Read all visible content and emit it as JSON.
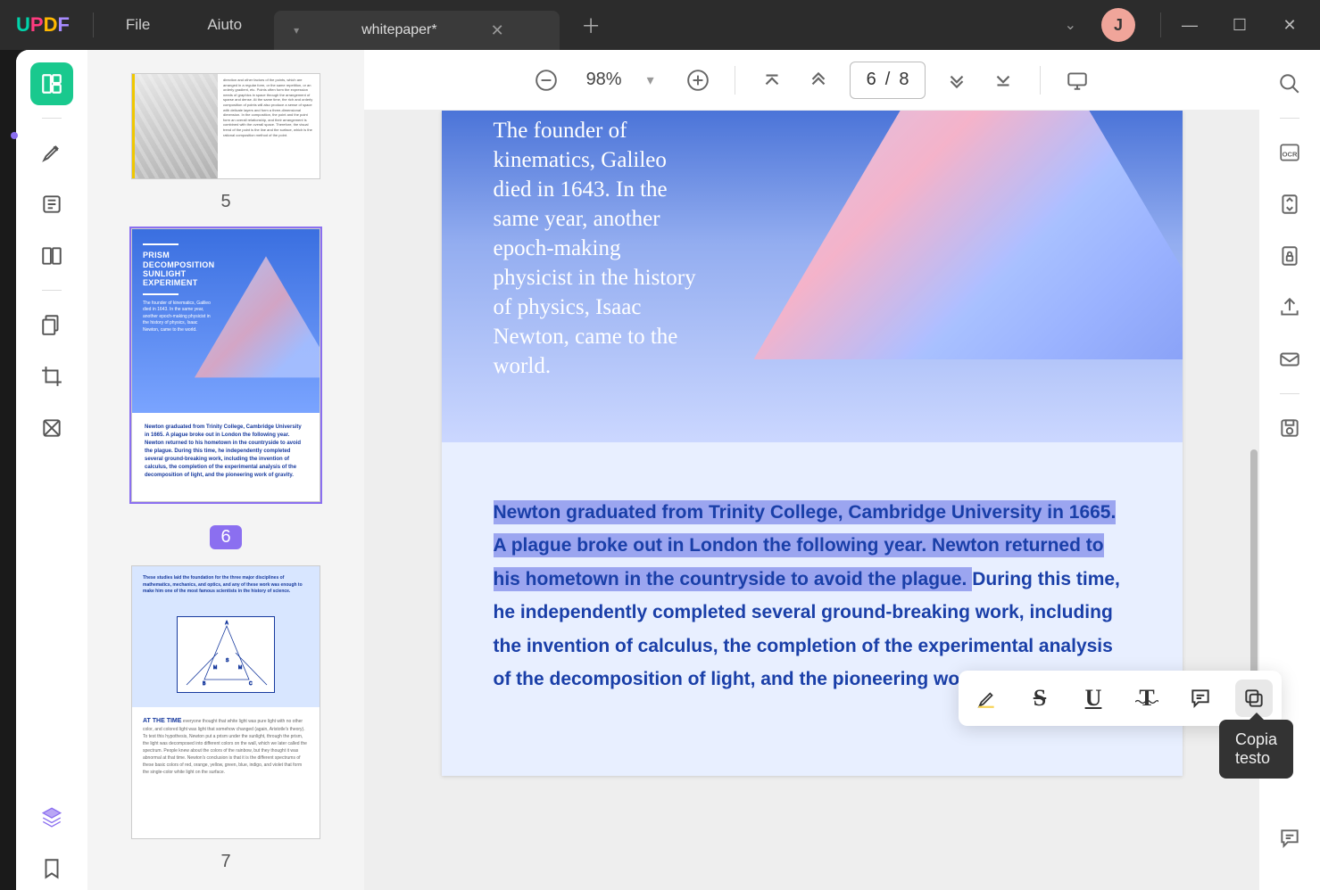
{
  "titlebar": {
    "logo": {
      "u": "U",
      "p": "P",
      "d": "D",
      "f": "F"
    },
    "menu_file": "File",
    "menu_help": "Aiuto",
    "tab_title": "whitepaper*",
    "avatar_letter": "J"
  },
  "toolbar": {
    "zoom": "98%",
    "page_current": "6",
    "page_sep": "/",
    "page_total": "8"
  },
  "thumbnails": {
    "labels": [
      "5",
      "6",
      "7"
    ],
    "t6_title": "PRISM\nDECOMPOSITION\nSUNLIGHT\nEXPERIMENT",
    "t6_body": "The founder of kinematics, Galileo died in 1643. In the same year, another epoch-making physicist in the history of physics, Isaac Newton, came to the world.",
    "t6_bottom": "Newton graduated from Trinity College, Cambridge University in 1665. A plague broke out in London the following year. Newton returned to his hometown in the countryside to avoid the plague. During this time, he independently completed several ground-breaking work, including the invention of calculus, the completion of the experimental analysis of the decomposition of light, and the pioneering work of gravity.",
    "t7_head": "These studies laid the foundation for the three major disciplines of mathematics, mechanics, and optics, and any of these work was enough to make him one of the most famous scientists in the history of science.",
    "t7_att": "AT THE TIME",
    "t7_body": "everyone thought that white light was pure light with no other color, and colored light was light that somehow changed (again, Aristotle's theory). To test this hypothesis, Newton put a prism under the sunlight, through the prism, the light was decomposed into different colors on the wall, which we later called the spectrum. People knew about the colors of the rainbow, but they thought it was abnormal at that time. Newton's conclusion is that it is the different spectrums of these basic colors of red, orange, yellow, green, blue, indigo, and violet that form the single-color white light on the surface."
  },
  "document": {
    "hero_text": "The founder of kinematics, Galileo died in 1643. In the same year, another epoch-making physicist in the history of physics, Isaac Newton, came to the world.",
    "body_highlight": "Newton graduated from Trinity College, Cambridge University in 1665. A plague broke out in London the following year. Newton returned to his hometown in the countryside to avoid the plague. ",
    "body_rest": "During this time, he independently completed several ground-breaking work, including the invention of calculus, the completion of the experimental analysis of the decomposition of light, and the pioneering work of gravity."
  },
  "selection_toolbar": {
    "tooltip": "Copia testo",
    "strike_glyph": "S",
    "underline_glyph": "U",
    "squiggle_glyph": "T"
  }
}
